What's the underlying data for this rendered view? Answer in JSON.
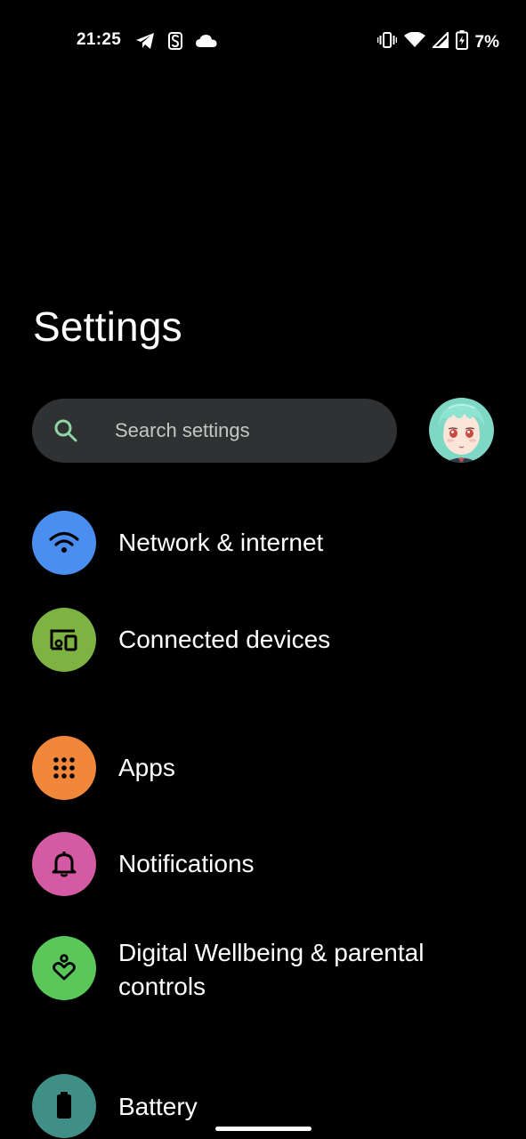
{
  "status_bar": {
    "time": "21:25",
    "left_icons": [
      "telegram-icon",
      "s-app-icon",
      "cloud-icon"
    ],
    "right_icons": [
      "vibrate-icon",
      "wifi-icon",
      "cell-signal-icon",
      "battery-charging-icon"
    ],
    "battery_percent": "7%"
  },
  "page": {
    "title": "Settings"
  },
  "search": {
    "placeholder": "Search settings",
    "icon": "search-icon",
    "icon_color": "#8fd5a6"
  },
  "avatar": {
    "icon": "avatar"
  },
  "settings_items": [
    {
      "label": "Network & internet",
      "icon": "wifi-icon",
      "color": "#4a8ff0"
    },
    {
      "label": "Connected devices",
      "icon": "devices-icon",
      "color": "#7cb342"
    },
    {
      "label": "Apps",
      "icon": "apps-grid-icon",
      "color": "#f0873a"
    },
    {
      "label": "Notifications",
      "icon": "bell-icon",
      "color": "#d45ba3"
    },
    {
      "label": "Digital Wellbeing & parental controls",
      "icon": "wellbeing-icon",
      "color": "#5ac75a"
    },
    {
      "label": "Battery",
      "icon": "battery-icon",
      "color": "#3f8f87"
    }
  ]
}
